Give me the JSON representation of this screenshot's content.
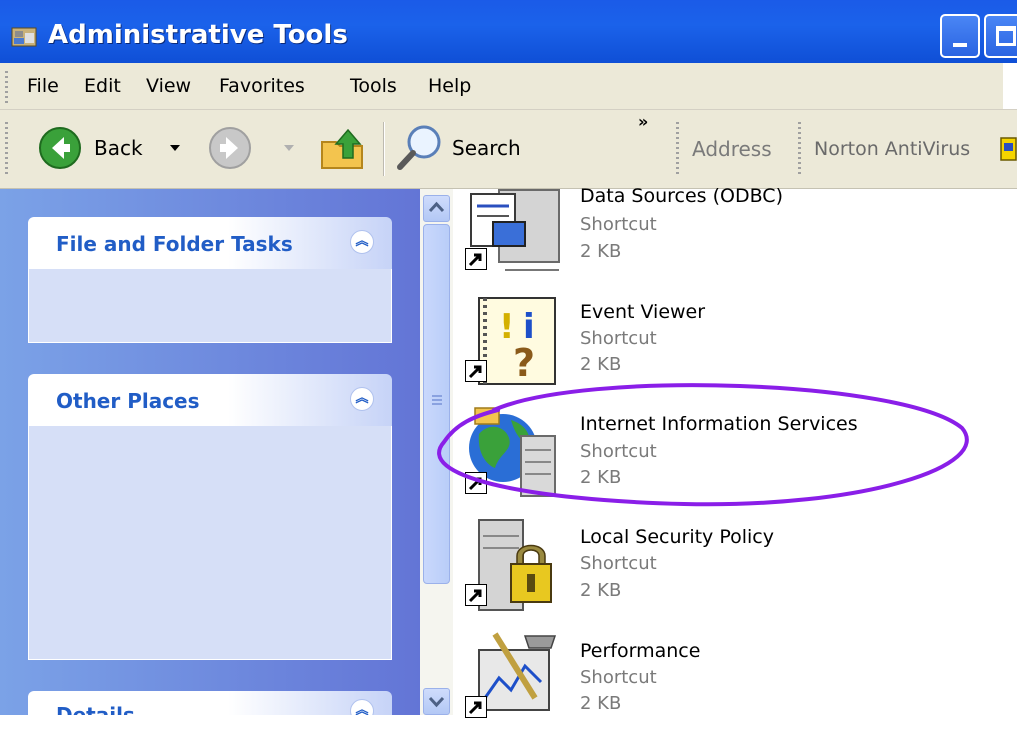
{
  "window": {
    "title": "Administrative Tools"
  },
  "menu": {
    "items": [
      "File",
      "Edit",
      "View",
      "Favorites",
      "Tools",
      "Help"
    ]
  },
  "toolbar": {
    "back_label": "Back",
    "search_label": "Search",
    "more_label": "»",
    "address_label": "Address",
    "norton_label": "Norton AntiVirus"
  },
  "task_pane": {
    "panels": [
      {
        "title": "File and Folder Tasks"
      },
      {
        "title": "Other Places"
      },
      {
        "title": "Details"
      }
    ]
  },
  "files": [
    {
      "name": "Data Sources (ODBC)",
      "type": "Shortcut",
      "size": "2 KB",
      "icon": "odbc-icon"
    },
    {
      "name": "Event Viewer",
      "type": "Shortcut",
      "size": "2 KB",
      "icon": "event-viewer-icon"
    },
    {
      "name": "Internet Information Services",
      "type": "Shortcut",
      "size": "2 KB",
      "icon": "iis-icon"
    },
    {
      "name": "Local Security Policy",
      "type": "Shortcut",
      "size": "2 KB",
      "icon": "security-policy-icon"
    },
    {
      "name": "Performance",
      "type": "Shortcut",
      "size": "2 KB",
      "icon": "performance-icon"
    }
  ],
  "colors": {
    "titlebar": "#1b5be8",
    "task_pane": "#6f8de0",
    "panel_title": "#215dc6",
    "annotation": "#8a1ee8"
  }
}
